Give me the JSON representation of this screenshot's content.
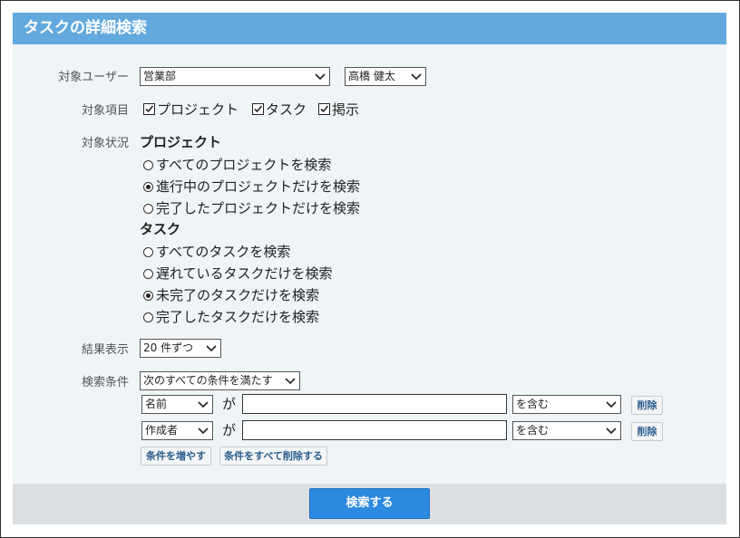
{
  "header": {
    "title": "タスクの詳細検索"
  },
  "labels": {
    "target_user": "対象ユーザー",
    "target_items": "対象項目",
    "target_status": "対象状況",
    "result_display": "結果表示",
    "search_condition": "検索条件"
  },
  "target_user": {
    "department": "営業部",
    "user": "高橋 健太"
  },
  "target_items": [
    {
      "label": "プロジェクト",
      "checked": true
    },
    {
      "label": "タスク",
      "checked": true
    },
    {
      "label": "掲示",
      "checked": true
    }
  ],
  "status": {
    "project": {
      "heading": "プロジェクト",
      "options": [
        {
          "label": "すべてのプロジェクトを検索",
          "selected": false
        },
        {
          "label": "進行中のプロジェクトだけを検索",
          "selected": true
        },
        {
          "label": "完了したプロジェクトだけを検索",
          "selected": false
        }
      ]
    },
    "task": {
      "heading": "タスク",
      "options": [
        {
          "label": "すべてのタスクを検索",
          "selected": false
        },
        {
          "label": "遅れているタスクだけを検索",
          "selected": false
        },
        {
          "label": "未完了のタスクだけを検索",
          "selected": true
        },
        {
          "label": "完了したタスクだけを検索",
          "selected": false
        }
      ]
    }
  },
  "result_display": {
    "value": "20 件ずつ"
  },
  "conditions": {
    "match_mode": "次のすべての条件を満たす",
    "rows": [
      {
        "field": "名前",
        "particle": "が",
        "value": "",
        "operator": "を含む",
        "delete_label": "削除"
      },
      {
        "field": "作成者",
        "particle": "が",
        "value": "",
        "operator": "を含む",
        "delete_label": "削除"
      }
    ],
    "add_label": "条件を増やす",
    "clear_label": "条件をすべて削除する"
  },
  "footer": {
    "search_label": "検索する"
  },
  "icons": {
    "dropdown": "chevron-down-icon",
    "checkbox": "checkbox-checked-icon",
    "radio": "radio-icon"
  },
  "colors": {
    "header_bg": "#62a9dd",
    "content_bg": "#eff4f7",
    "footer_bg": "#dcdfe2",
    "primary_button": "#2b8ae0"
  }
}
